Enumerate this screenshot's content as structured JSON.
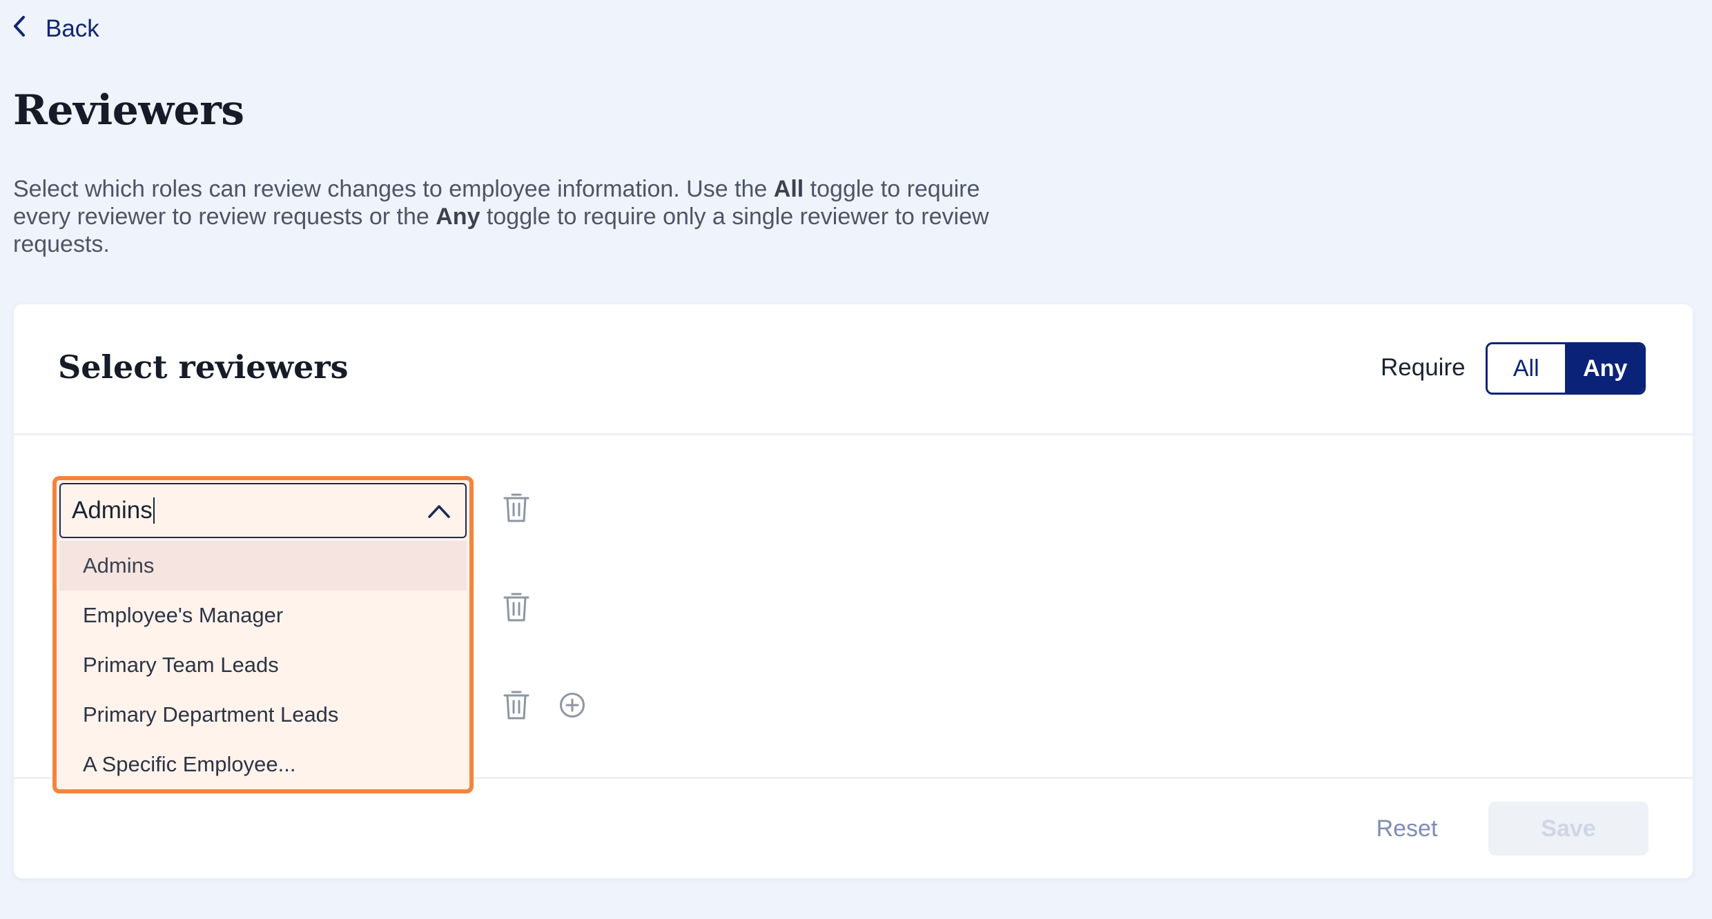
{
  "header": {
    "back_label": "Back",
    "title": "Reviewers"
  },
  "description": {
    "p1": "Select which roles can review changes to employee information. Use the ",
    "all_word": "All",
    "p2": " toggle to require every reviewer to review requests or the ",
    "any_word": "Any",
    "p3": " toggle to require only a single reviewer to review requests."
  },
  "card": {
    "title": "Select reviewers",
    "require_label": "Require",
    "toggle": {
      "all_label": "All",
      "any_label": "Any",
      "selected": "Any"
    },
    "reviewer_select": {
      "value": "Admins",
      "open": true,
      "options": [
        {
          "label": "Admins",
          "highlighted": true
        },
        {
          "label": "Employee's Manager",
          "highlighted": false
        },
        {
          "label": "Primary Team Leads",
          "highlighted": false
        },
        {
          "label": "Primary Department Leads",
          "highlighted": false
        },
        {
          "label": "A Specific Employee...",
          "highlighted": false
        }
      ]
    },
    "icons": {
      "delete": "trash-icon",
      "add": "plus-circle-icon",
      "dropdown": "chevron-up-icon",
      "back": "chevron-left-icon"
    },
    "footer": {
      "reset_label": "Reset",
      "save_label": "Save"
    }
  },
  "colors": {
    "brand": "#0a2378",
    "focus_outline": "#f5843a",
    "background": "#eff3fb",
    "disabled_text": "#cfd6e6"
  }
}
